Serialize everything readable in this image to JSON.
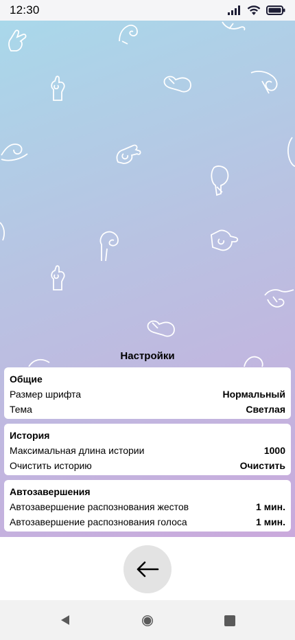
{
  "status_bar": {
    "time": "12:30",
    "icons": [
      "signal-icon",
      "wifi-icon",
      "battery-icon"
    ]
  },
  "settings": {
    "title": "Настройки",
    "sections": [
      {
        "title": "Общие",
        "rows": [
          {
            "label": "Размер шрифта",
            "value": "Нормальный"
          },
          {
            "label": "Тема",
            "value": "Светлая"
          }
        ]
      },
      {
        "title": "История",
        "rows": [
          {
            "label": "Максимальная длина истории",
            "value": "1000"
          },
          {
            "label": "Очистить историю",
            "value": "Очистить"
          }
        ]
      },
      {
        "title": "Автозавершения",
        "rows": [
          {
            "label": "Автозавершение распознования жестов",
            "value": "1 мин."
          },
          {
            "label": "Автозавершение распознования голоса",
            "value": "1 мин."
          }
        ]
      }
    ]
  },
  "footer": {
    "back_icon": "arrow-left-icon"
  },
  "nav_bar": {
    "icons": [
      "back-triangle-icon",
      "home-circle-icon",
      "recents-square-icon"
    ]
  },
  "colors": {
    "gradient_start": "#a9d8ea",
    "gradient_end": "#caa9dc",
    "card": "#ffffff",
    "back_button": "#e3e3e3"
  }
}
